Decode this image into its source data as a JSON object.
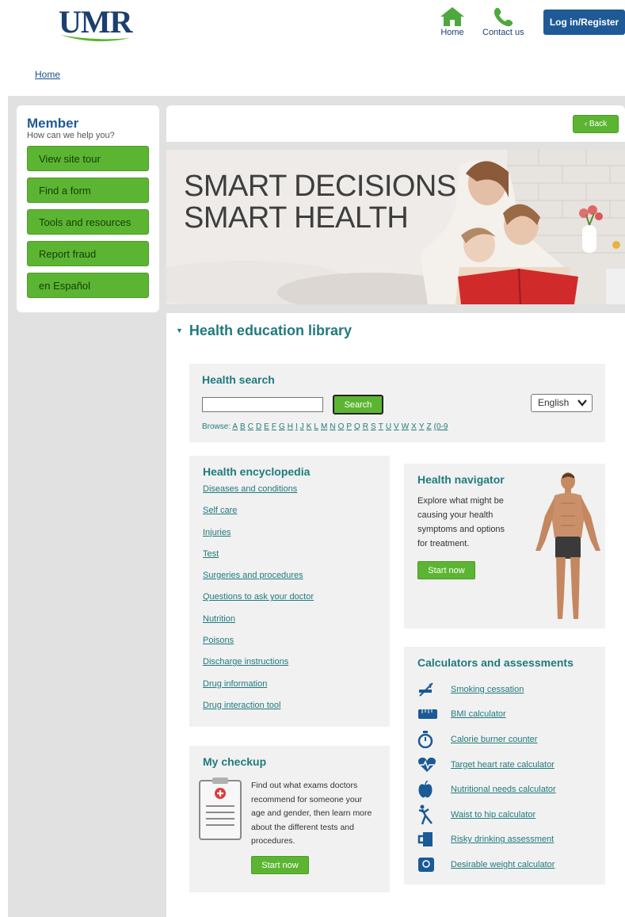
{
  "header": {
    "logo_text": "UMR",
    "home_label": "Home",
    "contact_label": "Contact us",
    "login_label": "Log in/Register",
    "colors": {
      "brand_blue": "#1f5a96",
      "brand_green": "#5cb532",
      "teal": "#207a7c"
    }
  },
  "breadcrumb": {
    "home": "Home"
  },
  "sidebar": {
    "title": "Member",
    "subtitle": "How can we help you?",
    "items": [
      {
        "label": "View site tour"
      },
      {
        "label": "Find a form"
      },
      {
        "label": "Tools and resources"
      },
      {
        "label": "Report fraud"
      },
      {
        "label": "en Español"
      }
    ]
  },
  "main": {
    "back_label": "‹  Back",
    "hero": {
      "line1": "SMART DECISIONS",
      "line2": "SMART HEALTH"
    },
    "section_title": "Health education library",
    "search": {
      "title": "Health search",
      "button": "Search",
      "language": "English",
      "browse_label": "Browse:",
      "letters": [
        "A",
        "B",
        "C",
        "D",
        "E",
        "F",
        "G",
        "H",
        "I",
        "J",
        "K",
        "L",
        "M",
        "N",
        "O",
        "P",
        "Q",
        "R",
        "S",
        "T",
        "U",
        "V",
        "W",
        "X",
        "Y",
        "Z",
        "(0-9"
      ]
    },
    "encyclopedia": {
      "title": "Health encyclopedia",
      "links": [
        "Diseases and conditions",
        "Self care",
        "Injuries",
        "Test",
        "Surgeries and procedures",
        "Questions to ask your doctor",
        "Nutrition",
        "Poisons",
        "Discharge instructions",
        "Drug information",
        "Drug interaction tool"
      ]
    },
    "navigator": {
      "title": "Health navigator",
      "description": "Explore what might be causing your health symptoms and options for treatment.",
      "button": "Start now"
    },
    "calculators": {
      "title": "Calculators and assessments",
      "items": [
        {
          "label": "Smoking cessation",
          "icon": "no-smoking-icon"
        },
        {
          "label": "BMI calculator",
          "icon": "tape-measure-icon"
        },
        {
          "label": "Calorie burner counter",
          "icon": "stopwatch-icon"
        },
        {
          "label": "Target heart rate calculator",
          "icon": "heart-rate-icon"
        },
        {
          "label": "Nutritional needs calculator",
          "icon": "apple-icon"
        },
        {
          "label": "Waist to hip calculator",
          "icon": "stretching-person-icon"
        },
        {
          "label": "Risky drinking assessment",
          "icon": "mug-icon"
        },
        {
          "label": "Desirable weight calculator",
          "icon": "scale-icon"
        }
      ]
    },
    "checkup": {
      "title": "My checkup",
      "description": "Find out what exams doctors recommend for someone your age and gender, then learn more about the different tests and procedures.",
      "button": "Start now"
    }
  }
}
